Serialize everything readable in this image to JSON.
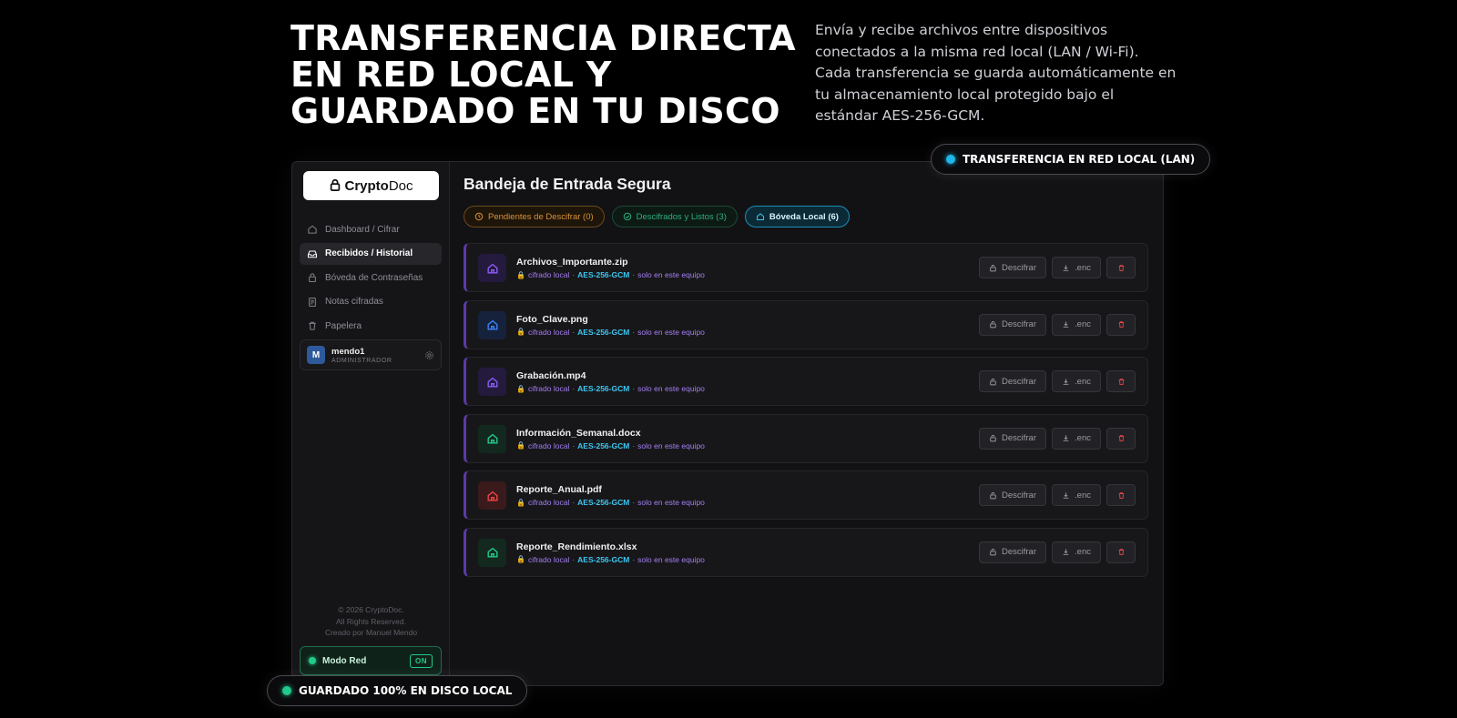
{
  "hero": {
    "title": "TRANSFERENCIA DIRECTA EN RED LOCAL Y GUARDADO EN TU DISCO",
    "description": "Envía y recibe archivos entre dispositivos conectados a la misma red local (LAN / Wi-Fi). Cada transferencia se guarda automáticamente en tu almacenamiento local protegido bajo el estándar AES-256-GCM."
  },
  "badges": {
    "lan": "TRANSFERENCIA EN RED LOCAL (LAN)",
    "disk": "GUARDADO 100% EN DISCO LOCAL"
  },
  "logo": {
    "part1": "rypto",
    "part2": "Doc",
    "lead": "C"
  },
  "sidebar": {
    "items": [
      {
        "label": "Dashboard / Cifrar",
        "icon": "home-icon",
        "active": false
      },
      {
        "label": "Recibidos / Historial",
        "icon": "inbox-icon",
        "active": true
      },
      {
        "label": "Bóveda de Contraseñas",
        "icon": "lock-icon",
        "active": false
      },
      {
        "label": "Notas cifradas",
        "icon": "note-icon",
        "active": false
      },
      {
        "label": "Papelera",
        "icon": "trash-icon",
        "active": false
      }
    ],
    "user": {
      "initial": "M",
      "name": "mendo1",
      "role": "ADMINISTRADOR"
    },
    "footer": {
      "line1": "© 2026 CryptoDoc.",
      "line2": "All Rights Reserved.",
      "line3": "Creado por Manuel Mendo"
    },
    "network": {
      "label": "Modo Red",
      "state": "ON"
    }
  },
  "main": {
    "title": "Bandeja de Entrada Segura",
    "tabs": [
      {
        "label": "Pendientes de Descifrar (0)"
      },
      {
        "label": "Descifrados y Listos (3)"
      },
      {
        "label": "Bóveda Local (6)"
      }
    ],
    "meta": {
      "local": "cifrado local",
      "algo": "AES-256-GCM",
      "device": "solo en este equipo"
    },
    "actions": {
      "decrypt": "Descifrar",
      "enc": ".enc"
    },
    "files": [
      {
        "name": "Archivos_Importante.zip",
        "icon_color": "#8b5cf6",
        "icon_bg": "#241a3d"
      },
      {
        "name": "Foto_Clave.png",
        "icon_color": "#3b82f6",
        "icon_bg": "#16223b"
      },
      {
        "name": "Grabación.mp4",
        "icon_color": "#8b5cf6",
        "icon_bg": "#241a3d"
      },
      {
        "name": "Información_Semanal.docx",
        "icon_color": "#22c98a",
        "icon_bg": "#13291f"
      },
      {
        "name": "Reporte_Anual.pdf",
        "icon_color": "#ef4444",
        "icon_bg": "#3a1a1b"
      },
      {
        "name": "Reporte_Rendimiento.xlsx",
        "icon_color": "#22c98a",
        "icon_bg": "#13291f"
      }
    ]
  }
}
